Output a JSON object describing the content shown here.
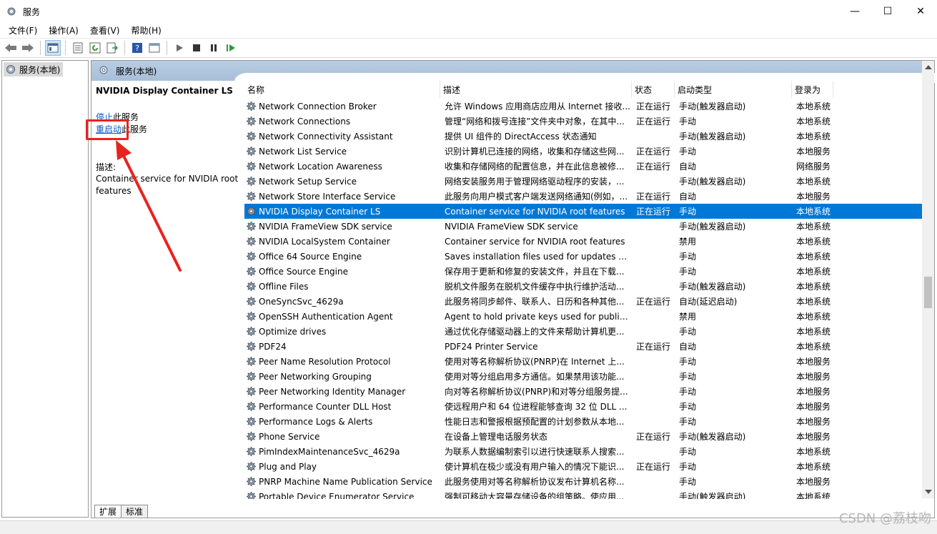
{
  "window": {
    "title": "服务",
    "controls": [
      "—",
      "☐",
      "✕"
    ]
  },
  "menu": [
    "文件(F)",
    "操作(A)",
    "查看(V)",
    "帮助(H)"
  ],
  "tree": {
    "root": "服务(本地)"
  },
  "panel": {
    "header": "服务(本地)",
    "service_title": "NVIDIA Display Container LS",
    "stop_link": "停止",
    "stop_suffix": "此服务",
    "restart_link": "重启动",
    "restart_suffix": "此服务",
    "desc_label": "描述:",
    "desc_text": "Container service for NVIDIA root features"
  },
  "columns": [
    "名称",
    "描述",
    "状态",
    "启动类型",
    "登录为"
  ],
  "rows": [
    [
      "Network Connection Broker",
      "允许 Windows 应用商店应用从 Internet 接收...",
      "正在运行",
      "手动(触发器启动)",
      "本地系统"
    ],
    [
      "Network Connections",
      "管理“网络和拨号连接”文件夹中对象，在其中...",
      "正在运行",
      "手动",
      "本地系统"
    ],
    [
      "Network Connectivity Assistant",
      "提供 UI 组件的 DirectAccess 状态通知",
      "",
      "手动(触发器启动)",
      "本地系统"
    ],
    [
      "Network List Service",
      "识别计算机已连接的网络，收集和存储这些网...",
      "正在运行",
      "手动",
      "本地服务"
    ],
    [
      "Network Location Awareness",
      "收集和存储网络的配置信息，并在此信息被修...",
      "正在运行",
      "自动",
      "网络服务"
    ],
    [
      "Network Setup Service",
      "网络安装服务用于管理网络驱动程序的安装，...",
      "",
      "手动(触发器启动)",
      "本地系统"
    ],
    [
      "Network Store Interface Service",
      "此服务向用户模式客户端发送网络通知(例如，...",
      "正在运行",
      "自动",
      "本地服务"
    ],
    [
      "NVIDIA Display Container LS",
      "Container service for NVIDIA root features",
      "正在运行",
      "手动",
      "本地系统"
    ],
    [
      "NVIDIA FrameView SDK service",
      "NVIDIA FrameView SDK service",
      "",
      "手动(触发器启动)",
      "本地系统"
    ],
    [
      "NVIDIA LocalSystem Container",
      "Container service for NVIDIA root features",
      "",
      "禁用",
      "本地系统"
    ],
    [
      "Office 64 Source Engine",
      "Saves installation files used for updates a...",
      "",
      "手动",
      "本地系统"
    ],
    [
      "Office Source Engine",
      "保存用于更新和修复的安装文件，并且在下载...",
      "",
      "手动",
      "本地系统"
    ],
    [
      "Offline Files",
      "脱机文件服务在脱机文件缓存中执行维护活动...",
      "",
      "手动(触发器启动)",
      "本地系统"
    ],
    [
      "OneSyncSvc_4629a",
      "此服务将同步邮件、联系人、日历和各种其他...",
      "正在运行",
      "自动(延迟启动)",
      "本地系统"
    ],
    [
      "OpenSSH Authentication Agent",
      "Agent to hold private keys used for public...",
      "",
      "禁用",
      "本地系统"
    ],
    [
      "Optimize drives",
      "通过优化存储驱动器上的文件来帮助计算机更...",
      "",
      "手动",
      "本地系统"
    ],
    [
      "PDF24",
      "PDF24 Printer Service",
      "正在运行",
      "自动",
      "本地系统"
    ],
    [
      "Peer Name Resolution Protocol",
      "使用对等名称解析协议(PNRP)在 Internet 上...",
      "",
      "手动",
      "本地服务"
    ],
    [
      "Peer Networking Grouping",
      "使用对等分组启用多方通信。如果禁用该功能...",
      "",
      "手动",
      "本地服务"
    ],
    [
      "Peer Networking Identity Manager",
      "向对等名称解析协议(PNRP)和对等分组服务提...",
      "",
      "手动",
      "本地服务"
    ],
    [
      "Performance Counter DLL Host",
      "使远程用户和 64 位进程能够查询 32 位 DLL ...",
      "",
      "手动",
      "本地服务"
    ],
    [
      "Performance Logs & Alerts",
      "性能日志和警报根据预配置的计划参数从本地...",
      "",
      "手动",
      "本地服务"
    ],
    [
      "Phone Service",
      "在设备上管理电话服务状态",
      "正在运行",
      "手动(触发器启动)",
      "本地服务"
    ],
    [
      "PimIndexMaintenanceSvc_4629a",
      "为联系人数据编制索引以进行快速联系人搜索...",
      "",
      "手动",
      "本地系统"
    ],
    [
      "Plug and Play",
      "使计算机在极少或没有用户输入的情况下能识...",
      "正在运行",
      "手动",
      "本地系统"
    ],
    [
      "PNRP Machine Name Publication Service",
      "此服务使用对等名称解析协议发布计算机名称...",
      "",
      "手动",
      "本地服务"
    ],
    [
      "Portable Device Enumerator Service",
      "强制可移动大容量存储设备的组策略。使应用...",
      "",
      "手动(触发器启动)",
      "本地系统"
    ]
  ],
  "tabs": [
    "扩展",
    "标准"
  ],
  "watermark": "CSDN @荔枝吻",
  "colors": {
    "selection": "#0078d7",
    "annotation": "#e8231f",
    "link": "#0b55c4"
  }
}
